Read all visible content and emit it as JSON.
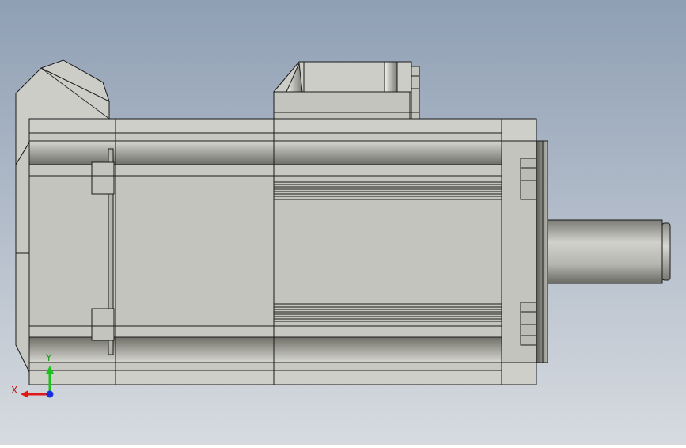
{
  "triad": {
    "x_label": "X",
    "y_label": "Y"
  },
  "colors": {
    "bg_top": "#8f9fb4",
    "bg_bottom": "#d7dbe0",
    "body": "#c4c4be",
    "body_light": "#d6d6d0",
    "body_dark": "#8a8a84",
    "edge": "#1a1a1a",
    "x_axis": "#e01818",
    "y_axis": "#1cc21c",
    "z_axis": "#1830e0"
  }
}
